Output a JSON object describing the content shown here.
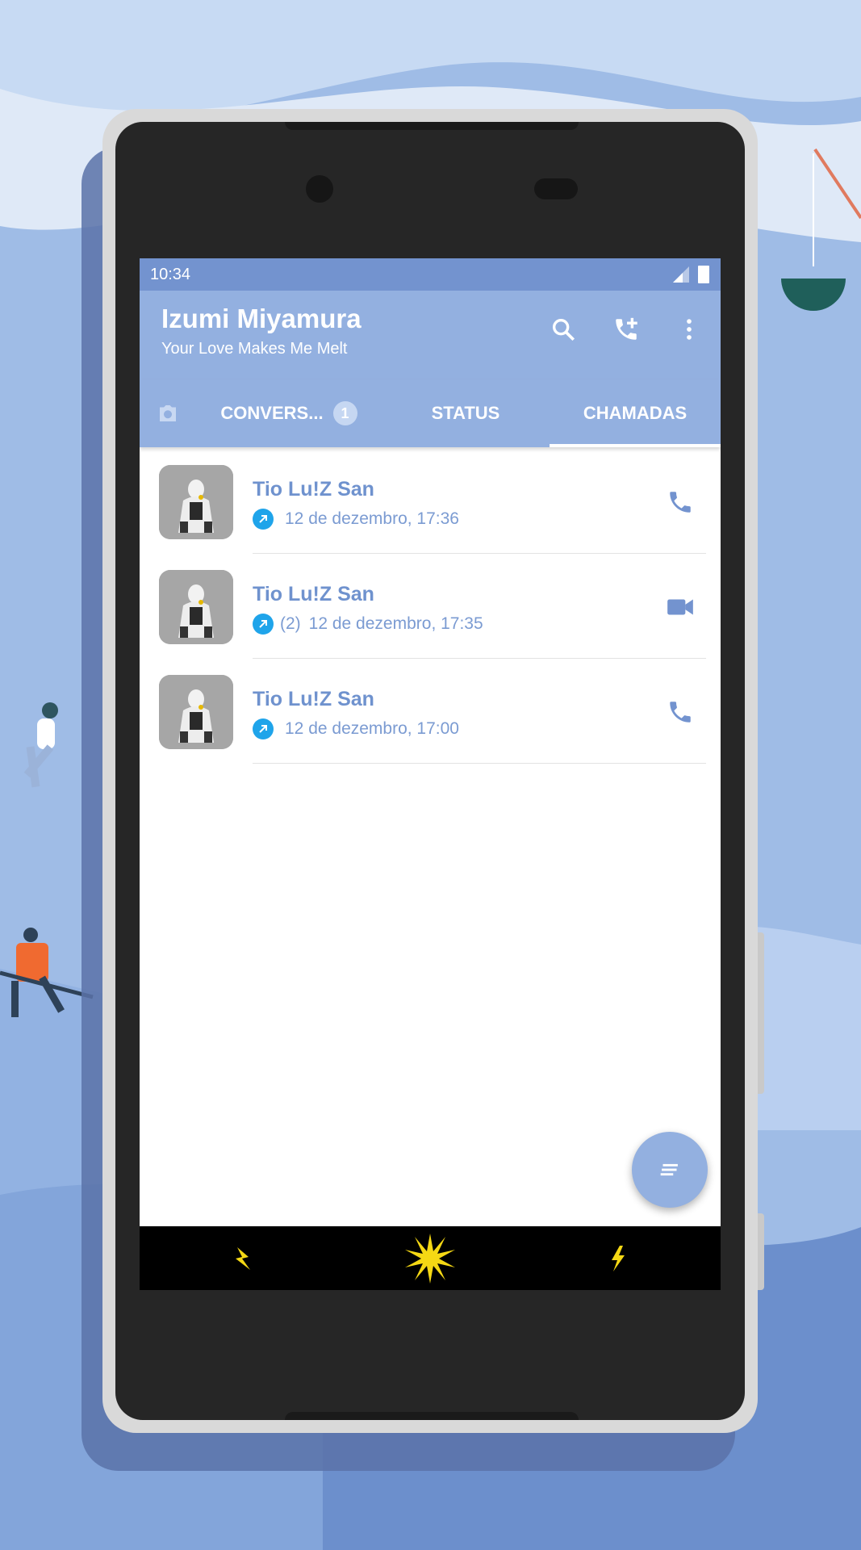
{
  "status_bar": {
    "time": "10:34"
  },
  "header": {
    "title": "Izumi Miyamura",
    "subtitle": "Your Love Makes Me Melt"
  },
  "tabs": [
    {
      "label": "CONVERS...",
      "badge": "1"
    },
    {
      "label": "STATUS"
    },
    {
      "label": "CHAMADAS",
      "selected": true
    }
  ],
  "calls": [
    {
      "name": "Tio Lu!Z San",
      "detail": "12 de dezembro, 17:36",
      "count": "",
      "direction": "outgoing",
      "type": "voice"
    },
    {
      "name": "Tio Lu!Z San",
      "detail": "12 de dezembro, 17:35",
      "count": "(2)",
      "direction": "outgoing",
      "type": "video"
    },
    {
      "name": "Tio Lu!Z San",
      "detail": "12 de dezembro, 17:00",
      "count": "",
      "direction": "outgoing",
      "type": "voice"
    }
  ],
  "colors": {
    "accent": "#93b0e0",
    "status_bar": "#7393cf",
    "text_accent": "#6f92ce",
    "outgoing_arrow": "#1fa4ea",
    "nav_icons": "#f5d814"
  },
  "icons": {
    "search": "search-icon",
    "new_call": "add-call-icon",
    "menu": "more-vert-icon",
    "camera": "camera-icon",
    "voice": "phone-icon",
    "video": "videocam-icon",
    "fab": "menu-lines-icon"
  }
}
